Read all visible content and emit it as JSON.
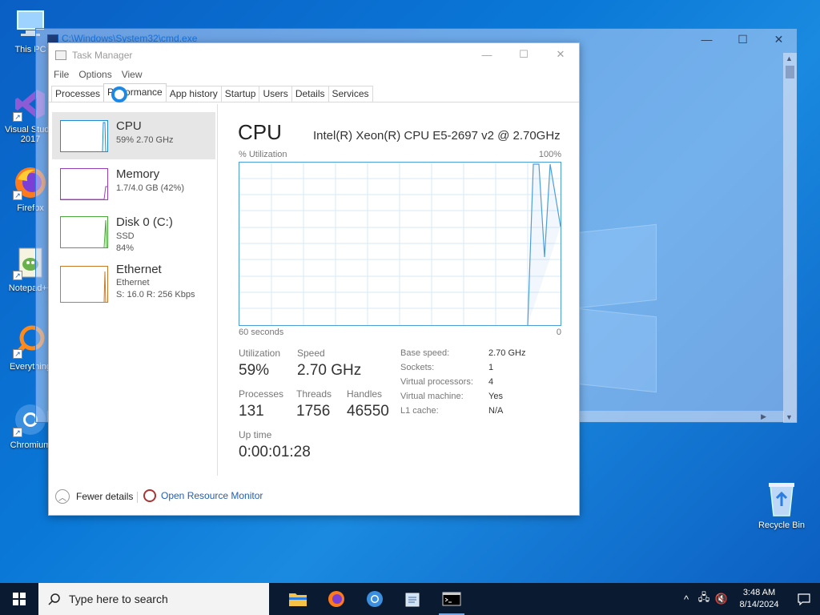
{
  "desktop": {
    "icons": [
      {
        "label": "This PC"
      },
      {
        "label": "Visual Studio 2017"
      },
      {
        "label": "Firefox"
      },
      {
        "label": "Notepad++"
      },
      {
        "label": "Everything"
      },
      {
        "label": "Chromium"
      }
    ],
    "recycle_bin": "Recycle Bin"
  },
  "cmd_window": {
    "title": "C:\\Windows\\System32\\cmd.exe"
  },
  "task_manager": {
    "title": "Task Manager",
    "menu": [
      "File",
      "Options",
      "View"
    ],
    "tabs": [
      "Processes",
      "Performance",
      "App history",
      "Startup",
      "Users",
      "Details",
      "Services"
    ],
    "active_tab": "Performance",
    "sidebar": {
      "cpu": {
        "name": "CPU",
        "sub1": "59% 2.70 GHz",
        "color": "#1e8bd6"
      },
      "memory": {
        "name": "Memory",
        "sub1": "1.7/4.0 GB (42%)",
        "color": "#9b3fb8"
      },
      "disk": {
        "name": "Disk 0 (C:)",
        "sub1": "SSD",
        "sub2": "84%",
        "color": "#4aa83a"
      },
      "ethernet": {
        "name": "Ethernet",
        "sub1": "Ethernet",
        "sub2": "S: 16.0  R: 256 Kbps",
        "color": "#c77a2a"
      }
    },
    "main": {
      "title": "CPU",
      "model": "Intel(R) Xeon(R) CPU E5-2697 v2 @ 2.70GHz",
      "util_label": "% Utilization",
      "util_max": "100%",
      "axis_left": "60 seconds",
      "axis_right": "0",
      "stats": {
        "utilization": {
          "label": "Utilization",
          "value": "59%"
        },
        "speed": {
          "label": "Speed",
          "value": "2.70 GHz"
        },
        "processes": {
          "label": "Processes",
          "value": "131"
        },
        "threads": {
          "label": "Threads",
          "value": "1756"
        },
        "handles": {
          "label": "Handles",
          "value": "46550"
        },
        "uptime": {
          "label": "Up time",
          "value": "0:00:01:28"
        }
      },
      "specs": [
        {
          "k": "Base speed:",
          "v": "2.70 GHz"
        },
        {
          "k": "Sockets:",
          "v": "1"
        },
        {
          "k": "Virtual processors:",
          "v": "4"
        },
        {
          "k": "Virtual machine:",
          "v": "Yes"
        },
        {
          "k": "L1 cache:",
          "v": "N/A"
        }
      ]
    },
    "footer": {
      "fewer_details": "Fewer details",
      "open_resource_monitor": "Open Resource Monitor"
    }
  },
  "taskbar": {
    "search_placeholder": "Type here to search",
    "apps": [
      "file-explorer",
      "firefox",
      "chromium",
      "notepad",
      "cmd"
    ],
    "clock_time": "3:48 AM",
    "clock_date": "8/14/2024"
  }
}
